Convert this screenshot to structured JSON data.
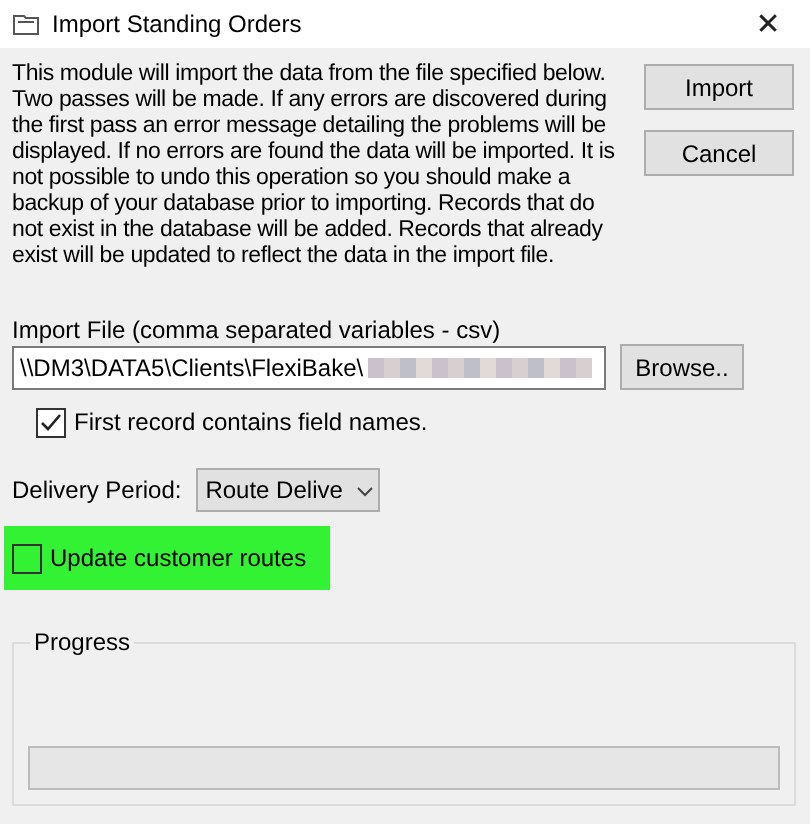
{
  "window": {
    "title": "Import Standing Orders",
    "close": "✕"
  },
  "description": "This module will import the data from the file specified below. Two passes will be made. If any errors are discovered during the first pass an error message detailing the problems will be displayed. If no errors are found the data will be imported. It is not possible to undo this operation so you should make a backup of your database prior to importing. Records that do not exist in the database will be added. Records that already exist will be updated to reflect the data in the import file.",
  "buttons": [
    {
      "label": "Import"
    },
    {
      "label": "Cancel"
    }
  ],
  "import_file": {
    "label": "Import File (comma separated variables - csv)",
    "value": "\\\\DM3\\DATA5\\Clients\\FlexiBake\\",
    "redacted": true,
    "browse": "Browse.."
  },
  "first_record_checkbox": {
    "label": "First record contains field names.",
    "checked": true
  },
  "delivery_period": {
    "label": "Delivery Period:",
    "value": "Route Delive"
  },
  "update_routes_checkbox": {
    "label": "Update customer routes",
    "checked": false,
    "highlighted": true
  },
  "progress": {
    "title": "Progress",
    "level": 0
  }
}
